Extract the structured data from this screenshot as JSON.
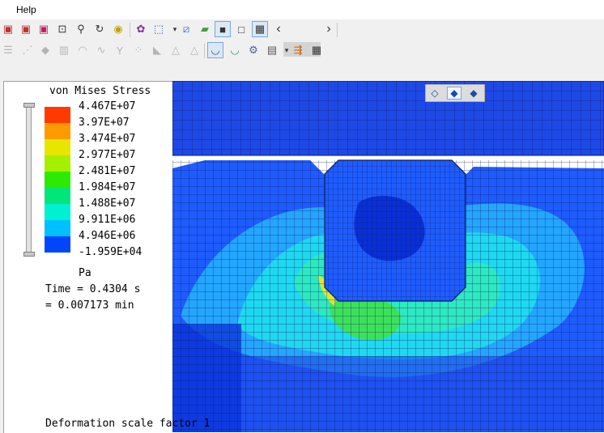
{
  "menubar": {
    "items": [
      "Help"
    ]
  },
  "toolbar1": {
    "icons": [
      "render-box-icon",
      "render-box-red-icon",
      "render-box-pink-icon",
      "zoom-box-icon",
      "magnifier-icon",
      "rotate-icon",
      "fit-view-icon",
      "palette-icon",
      "select-cube-icon",
      "axes-icon",
      "surface-icon",
      "shaded-cube-icon",
      "wire-cube-icon",
      "hidden-cube-icon"
    ],
    "scroll_left": "‹",
    "scroll_right": "›"
  },
  "toolbar2": {
    "icons": [
      "list-icon",
      "node-icon",
      "element-icon",
      "face-icon",
      "edge-icon",
      "spring-icon",
      "branch-icon",
      "dots-icon",
      "point-icon",
      "mesh-triangle-icon",
      "outline-triangle-icon",
      "bowl-icon",
      "bowl-green-icon",
      "toolbox-icon",
      "film-icon",
      "arrows-icon",
      "table-icon"
    ]
  },
  "legend": {
    "title": "von Mises Stress",
    "colors": [
      "#ff3a00",
      "#ff9a00",
      "#e6e600",
      "#a4f000",
      "#2eea00",
      "#00e67a",
      "#00f0d2",
      "#00c0ff",
      "#0046ff"
    ],
    "labels": [
      "4.467E+07",
      "3.97E+07",
      "3.474E+07",
      "2.977E+07",
      "2.481E+07",
      "1.984E+07",
      "1.488E+07",
      "9.911E+06",
      "4.946E+06",
      "-1.959E+04"
    ],
    "unit": "Pa",
    "time_line1": "Time = 0.4304 s",
    "time_line2": "= 0.007173 min"
  },
  "footer": {
    "deformation": "Deformation scale factor 1"
  },
  "view_buttons": {
    "icons": [
      "front-cube-icon",
      "iso-cube-icon",
      "back-cube-icon"
    ]
  },
  "colors": {
    "deep_blue": "#0a2fd6",
    "blue": "#1f5cff",
    "light_blue": "#24a6ff",
    "cyan": "#20d8f0",
    "aqua": "#2ee8c0",
    "green": "#3de05a",
    "yellow": "#d8e83a"
  }
}
